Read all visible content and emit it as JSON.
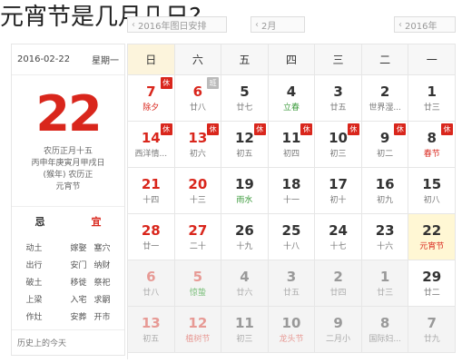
{
  "title": "元宵节是几月几日?",
  "toolbar": {
    "date_box": "2016年图日安排",
    "month_box": "2月",
    "year_box": "2016年"
  },
  "left": {
    "date_line": "2016-02-22",
    "weekday": "星期一",
    "big_day": "22",
    "lunar_lines": [
      "农历正月十五",
      "丙申年庚寅月甲戌日",
      "(猴年) 农历正",
      "元宵节"
    ],
    "yi_label": "宜",
    "ji_label": "忌",
    "yi_items": [
      "嫁娶",
      "安门",
      "移徙",
      "入宅",
      "安葬"
    ],
    "yi_items2": [
      "塞穴",
      "纳财",
      "祭祀",
      "求嗣",
      "开市"
    ],
    "ji_items": [
      "动土",
      "出行",
      "破土",
      "上梁",
      "作灶"
    ],
    "footer_left": "历史上的今天",
    "footer_right": ""
  },
  "weekdays": [
    "日",
    "六",
    "五",
    "四",
    "三",
    "二",
    "一"
  ],
  "weeks": [
    [
      {
        "n": "7",
        "s": "除夕",
        "red": true,
        "sred": true,
        "badge": "休"
      },
      {
        "n": "6",
        "s": "廿八",
        "red": true,
        "badge": "班"
      },
      {
        "n": "5",
        "s": "廿七"
      },
      {
        "n": "4",
        "s": "立春",
        "sgreen": true
      },
      {
        "n": "3",
        "s": "廿五"
      },
      {
        "n": "2",
        "s": "世界湿..."
      },
      {
        "n": "1",
        "s": "廿三"
      }
    ],
    [
      {
        "n": "14",
        "s": "西洋情...",
        "red": true,
        "badge": "休"
      },
      {
        "n": "13",
        "s": "初六",
        "red": true,
        "badge": "休"
      },
      {
        "n": "12",
        "s": "初五",
        "badge": "休"
      },
      {
        "n": "11",
        "s": "初四",
        "badge": "休"
      },
      {
        "n": "10",
        "s": "初三",
        "badge": "休"
      },
      {
        "n": "9",
        "s": "初二",
        "badge": "休"
      },
      {
        "n": "8",
        "s": "春节",
        "sred": true,
        "badge": "休"
      }
    ],
    [
      {
        "n": "21",
        "s": "十四",
        "red": true
      },
      {
        "n": "20",
        "s": "十三",
        "red": true
      },
      {
        "n": "19",
        "s": "雨水",
        "sgreen": true
      },
      {
        "n": "18",
        "s": "十一"
      },
      {
        "n": "17",
        "s": "初十"
      },
      {
        "n": "16",
        "s": "初九"
      },
      {
        "n": "15",
        "s": "初八"
      }
    ],
    [
      {
        "n": "28",
        "s": "廿一",
        "red": true
      },
      {
        "n": "27",
        "s": "二十",
        "red": true
      },
      {
        "n": "26",
        "s": "十九"
      },
      {
        "n": "25",
        "s": "十八"
      },
      {
        "n": "24",
        "s": "十七"
      },
      {
        "n": "23",
        "s": "十六"
      },
      {
        "n": "22",
        "s": "元宵节",
        "sred": true,
        "today": true
      }
    ],
    [
      {
        "n": "6",
        "s": "廿八",
        "red": true,
        "other": true
      },
      {
        "n": "5",
        "s": "惊蛰",
        "red": true,
        "sgreen": true,
        "other": true
      },
      {
        "n": "4",
        "s": "廿六",
        "other": true
      },
      {
        "n": "3",
        "s": "廿五",
        "other": true
      },
      {
        "n": "2",
        "s": "廿四",
        "other": true
      },
      {
        "n": "1",
        "s": "廿三",
        "other": true
      },
      {
        "n": "29",
        "s": "廿二"
      }
    ],
    [
      {
        "n": "13",
        "s": "初五",
        "red": true,
        "other": true
      },
      {
        "n": "12",
        "s": "植树节",
        "red": true,
        "sred": true,
        "other": true
      },
      {
        "n": "11",
        "s": "初三",
        "other": true
      },
      {
        "n": "10",
        "s": "龙头节",
        "sred": true,
        "other": true
      },
      {
        "n": "9",
        "s": "二月小",
        "other": true
      },
      {
        "n": "8",
        "s": "国际妇...",
        "other": true
      },
      {
        "n": "7",
        "s": "廿九",
        "other": true
      }
    ]
  ]
}
